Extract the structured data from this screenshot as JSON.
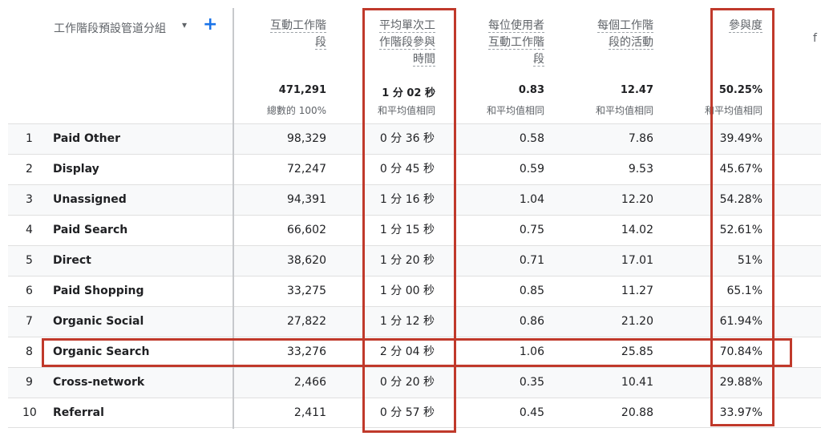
{
  "dimension": {
    "title": "工作階段預設管道分組",
    "caret": "▾",
    "add": "+"
  },
  "columns": [
    {
      "label": "互動工作階段",
      "total": "471,291",
      "sub": "總數的 100%"
    },
    {
      "label": "平均單次工作階段參與時間",
      "total": "1 分 02 秒",
      "sub": "和平均值相同"
    },
    {
      "label": "每位使用者互動工作階段",
      "total": "0.83",
      "sub": "和平均值相同"
    },
    {
      "label": "每個工作階段的活動",
      "total": "12.47",
      "sub": "和平均值相同"
    },
    {
      "label": "參與度",
      "total": "50.25%",
      "sub": "和平均值相同"
    }
  ],
  "right_cut": "f",
  "rows": [
    {
      "idx": "1",
      "name": "Paid Other",
      "c1": "98,329",
      "c2": "0 分 36 秒",
      "c3": "0.58",
      "c4": "7.86",
      "c5": "39.49%"
    },
    {
      "idx": "2",
      "name": "Display",
      "c1": "72,247",
      "c2": "0 分 45 秒",
      "c3": "0.59",
      "c4": "9.53",
      "c5": "45.67%"
    },
    {
      "idx": "3",
      "name": "Unassigned",
      "c1": "94,391",
      "c2": "1 分 16 秒",
      "c3": "1.04",
      "c4": "12.20",
      "c5": "54.28%"
    },
    {
      "idx": "4",
      "name": "Paid Search",
      "c1": "66,602",
      "c2": "1 分 15 秒",
      "c3": "0.75",
      "c4": "14.02",
      "c5": "52.61%"
    },
    {
      "idx": "5",
      "name": "Direct",
      "c1": "38,620",
      "c2": "1 分 20 秒",
      "c3": "0.71",
      "c4": "17.01",
      "c5": "51%"
    },
    {
      "idx": "6",
      "name": "Paid Shopping",
      "c1": "33,275",
      "c2": "1 分 00 秒",
      "c3": "0.85",
      "c4": "11.27",
      "c5": "65.1%"
    },
    {
      "idx": "7",
      "name": "Organic Social",
      "c1": "27,822",
      "c2": "1 分 12 秒",
      "c3": "0.86",
      "c4": "21.20",
      "c5": "61.94%"
    },
    {
      "idx": "8",
      "name": "Organic Search",
      "c1": "33,276",
      "c2": "2 分 04 秒",
      "c3": "1.06",
      "c4": "25.85",
      "c5": "70.84%"
    },
    {
      "idx": "9",
      "name": "Cross-network",
      "c1": "2,466",
      "c2": "0 分 20 秒",
      "c3": "0.35",
      "c4": "10.41",
      "c5": "29.88%"
    },
    {
      "idx": "10",
      "name": "Referral",
      "c1": "2,411",
      "c2": "0 分 57 秒",
      "c3": "0.45",
      "c4": "20.88",
      "c5": "33.97%"
    }
  ],
  "highlight_color": "#c0392b"
}
